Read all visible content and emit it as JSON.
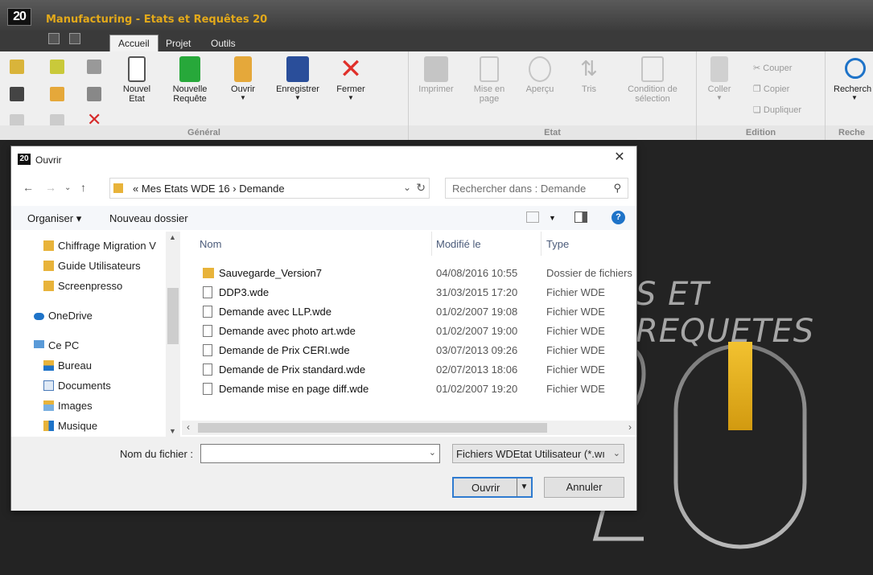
{
  "app": {
    "logo": "20",
    "title": "Manufacturing - Etats et Requêtes 20",
    "tabs": [
      "Accueil",
      "Projet",
      "Outils"
    ]
  },
  "ribbon": {
    "groups": {
      "general": {
        "label": "Général",
        "buttons": {
          "new_state": "Nouvel Etat",
          "new_query": "Nouvelle Requête",
          "open": "Ouvrir",
          "save": "Enregistrer",
          "close": "Fermer"
        }
      },
      "etat": {
        "label": "Etat",
        "buttons": {
          "print": "Imprimer",
          "layout": "Mise en page",
          "preview": "Aperçu",
          "sort": "Tris",
          "selection": "Condition de sélection"
        }
      },
      "edition": {
        "label": "Edition",
        "buttons": {
          "paste": "Coller",
          "cut": "Couper",
          "copy": "Copier",
          "duplicate": "Dupliquer"
        }
      },
      "recherche": {
        "label": "Reche",
        "buttons": {
          "search": "Recherch"
        }
      }
    }
  },
  "background": {
    "brand_text": "S ET REQUETES",
    "big_number": "20"
  },
  "dialog": {
    "icon": "20",
    "title": "Ouvrir",
    "close_glyph": "✕",
    "breadcrumb": "« Mes Etats WDE 16 › Demande",
    "search_placeholder": "Rechercher dans : Demande",
    "organize": "Organiser ▾",
    "new_folder": "Nouveau dossier",
    "nav_items": [
      {
        "label": "Chiffrage Migration V",
        "icon": "folder-icon"
      },
      {
        "label": "Guide Utilisateurs",
        "icon": "folder-icon"
      },
      {
        "label": "Screenpresso",
        "icon": "folder-icon"
      },
      {
        "label": "OneDrive",
        "icon": "cloud-icon"
      },
      {
        "label": "Ce PC",
        "icon": "computer-icon"
      },
      {
        "label": "Bureau",
        "icon": "desktop-folder-icon"
      },
      {
        "label": "Documents",
        "icon": "documents-icon"
      },
      {
        "label": "Images",
        "icon": "images-icon"
      },
      {
        "label": "Musique",
        "icon": "music-icon"
      }
    ],
    "columns": {
      "name": "Nom",
      "modified": "Modifié le",
      "type": "Type"
    },
    "files": [
      {
        "name": "Sauvegarde_Version7",
        "date": "04/08/2016 10:55",
        "type": "Dossier de fichiers",
        "folder": true
      },
      {
        "name": "DDP3.wde",
        "date": "31/03/2015 17:20",
        "type": "Fichier WDE",
        "folder": false
      },
      {
        "name": "Demande avec LLP.wde",
        "date": "01/02/2007 19:08",
        "type": "Fichier WDE",
        "folder": false
      },
      {
        "name": "Demande avec photo art.wde",
        "date": "01/02/2007 19:00",
        "type": "Fichier WDE",
        "folder": false
      },
      {
        "name": "Demande de Prix CERI.wde",
        "date": "03/07/2013 09:26",
        "type": "Fichier WDE",
        "folder": false
      },
      {
        "name": "Demande de Prix standard.wde",
        "date": "02/07/2013 18:06",
        "type": "Fichier WDE",
        "folder": false
      },
      {
        "name": "Demande mise en page diff.wde",
        "date": "01/02/2007 19:20",
        "type": "Fichier WDE",
        "folder": false
      }
    ],
    "filename_label": "Nom du fichier :",
    "filename_value": "",
    "filter": "Fichiers WDEtat Utilisateur (*.wı",
    "open_button": "Ouvrir",
    "cancel_button": "Annuler"
  },
  "colors": {
    "accent": "#e3a91a",
    "folder": "#e8b33a",
    "focus": "#2f7bd0"
  }
}
